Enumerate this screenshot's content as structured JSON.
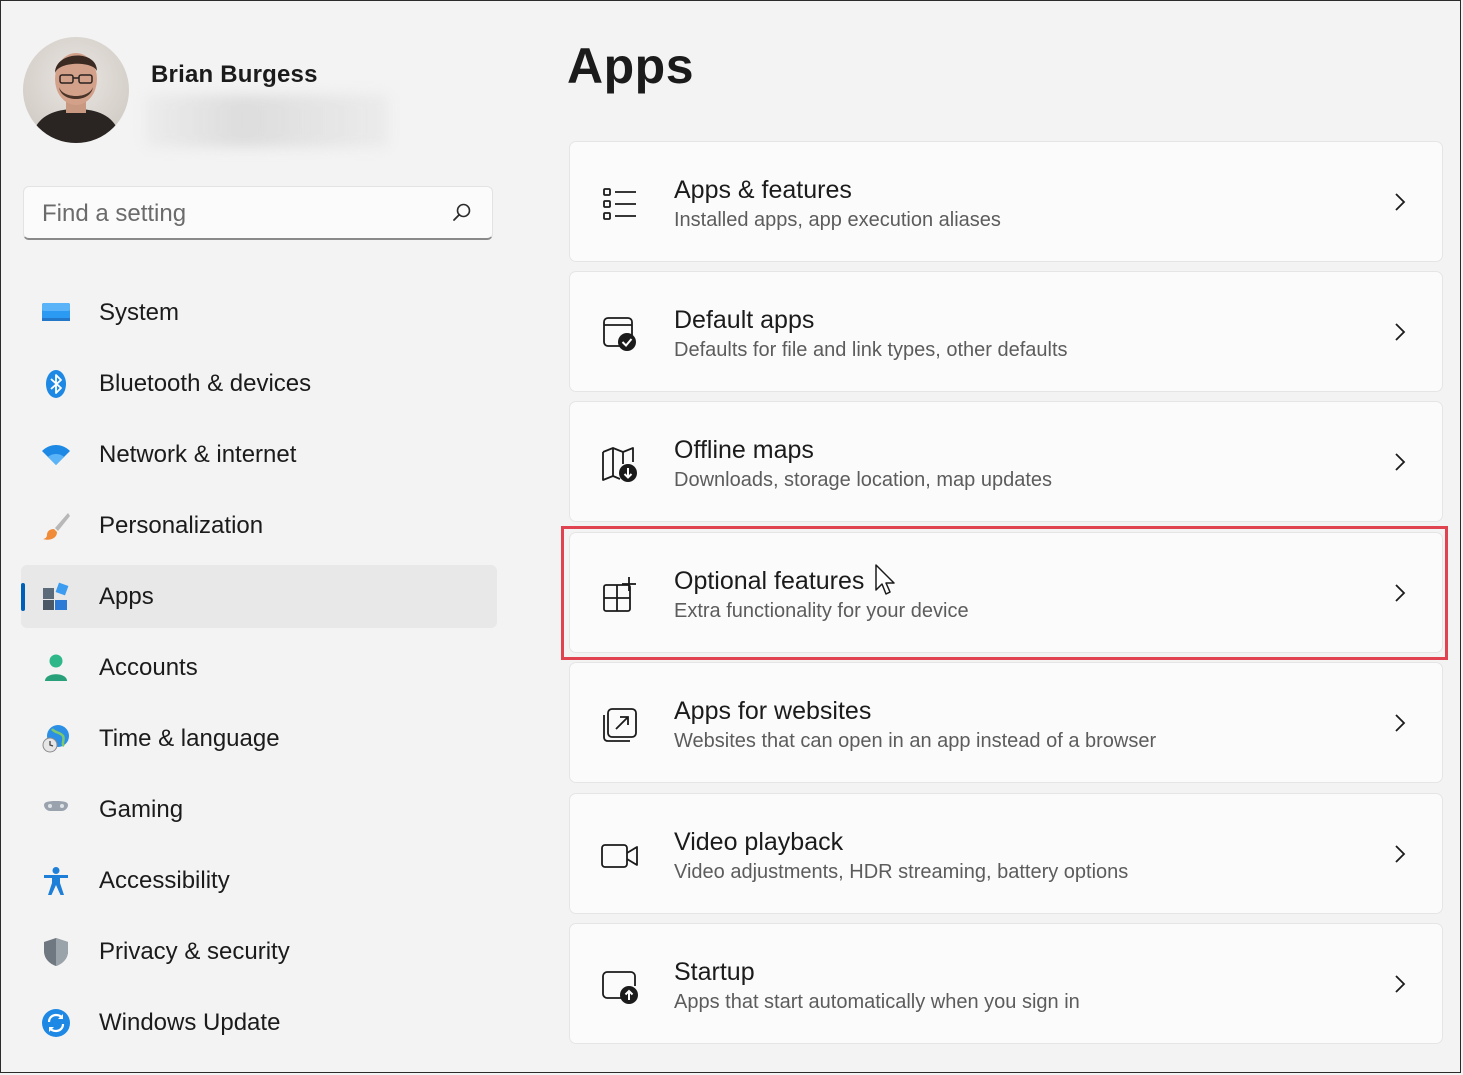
{
  "profile": {
    "name": "Brian Burgess"
  },
  "search": {
    "placeholder": "Find a setting"
  },
  "nav": {
    "items": [
      {
        "label": "System",
        "icon": "system-icon"
      },
      {
        "label": "Bluetooth & devices",
        "icon": "bluetooth-icon"
      },
      {
        "label": "Network & internet",
        "icon": "wifi-icon"
      },
      {
        "label": "Personalization",
        "icon": "brush-icon"
      },
      {
        "label": "Apps",
        "icon": "apps-icon",
        "selected": true
      },
      {
        "label": "Accounts",
        "icon": "person-icon"
      },
      {
        "label": "Time & language",
        "icon": "globe-clock-icon"
      },
      {
        "label": "Gaming",
        "icon": "gamepad-icon"
      },
      {
        "label": "Accessibility",
        "icon": "accessibility-icon"
      },
      {
        "label": "Privacy & security",
        "icon": "shield-icon"
      },
      {
        "label": "Windows Update",
        "icon": "refresh-icon"
      }
    ]
  },
  "main": {
    "title": "Apps",
    "cards": [
      {
        "title": "Apps & features",
        "subtitle": "Installed apps, app execution aliases",
        "icon": "list-icon"
      },
      {
        "title": "Default apps",
        "subtitle": "Defaults for file and link types, other defaults",
        "icon": "default-apps-icon"
      },
      {
        "title": "Offline maps",
        "subtitle": "Downloads, storage location, map updates",
        "icon": "map-download-icon"
      },
      {
        "title": "Optional features",
        "subtitle": "Extra functionality for your device",
        "icon": "grid-add-icon",
        "highlighted": true
      },
      {
        "title": "Apps for websites",
        "subtitle": "Websites that can open in an app instead of a browser",
        "icon": "open-in-app-icon"
      },
      {
        "title": "Video playback",
        "subtitle": "Video adjustments, HDR streaming, battery options",
        "icon": "video-icon"
      },
      {
        "title": "Startup",
        "subtitle": "Apps that start automatically when you sign in",
        "icon": "startup-icon"
      }
    ]
  },
  "colors": {
    "accent": "#005fb8",
    "highlight": "#e0434f"
  }
}
